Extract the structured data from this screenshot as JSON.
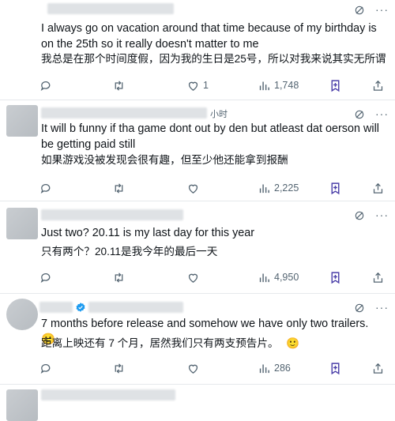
{
  "replies": [
    {
      "time": "",
      "text": "I always go on vacation around that time because of my birthday is on the 25th so it really doesn't matter to me",
      "translation": "我总是在那个时间度假，因为我的生日是25号，所以对我来说其实无所谓",
      "reply_count": "",
      "retweet_count": "",
      "like_count": "1",
      "view_count": "1,748"
    },
    {
      "time": "小时",
      "text": "It will b funny if tha game dont out by den but atleast dat oerson will be getting paid still",
      "translation": "如果游戏没被发现会很有趣，但至少他还能拿到报酬",
      "reply_count": "",
      "retweet_count": "",
      "like_count": "",
      "view_count": "2,225"
    },
    {
      "time": "",
      "text": "Just two? 20.11 is my last day for this year",
      "translation": "只有两个？20.11是我今年的最后一天",
      "reply_count": "",
      "retweet_count": "",
      "like_count": "",
      "view_count": "4,950"
    },
    {
      "time": "",
      "text": "7 months before release and somehow we have only two trailers.",
      "text_emoji": "🙂",
      "translation": "距离上映还有 7 个月，居然我们只有两支预告片。",
      "translation_emoji": "🙂",
      "reply_count": "",
      "retweet_count": "",
      "like_count": "",
      "view_count": "286"
    }
  ],
  "colors": {
    "text": "#0f1419",
    "muted": "#536471",
    "separator": "#e6e9ec",
    "accent_bookmark": "#4a3ea8"
  },
  "icons": [
    "grok-icon",
    "more-icon",
    "reply-icon",
    "retweet-icon",
    "like-icon",
    "views-icon",
    "bookmark-icon",
    "share-icon",
    "verified-badge-icon"
  ]
}
